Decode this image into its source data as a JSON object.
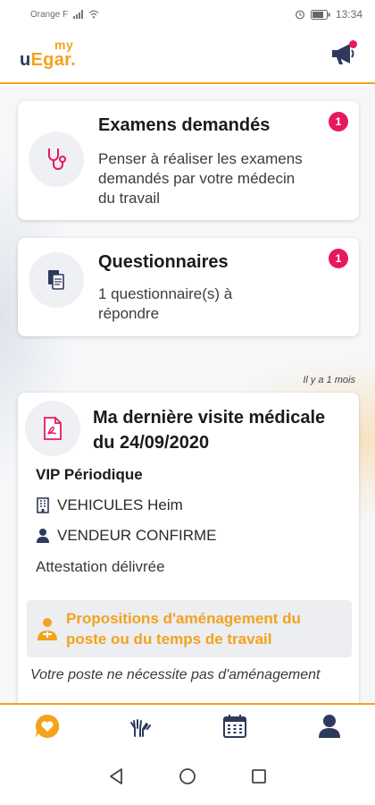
{
  "status_bar": {
    "carrier": "Orange F",
    "time": "13:34"
  },
  "header": {
    "logo_my": "my",
    "logo_u": "u",
    "logo_main": "Egar."
  },
  "cards": {
    "exams": {
      "title": "Examens demandés",
      "text": "Penser à réaliser les examens demandés par votre médecin du travail",
      "badge": "1"
    },
    "questionnaires": {
      "title": "Questionnaires",
      "text": "1 questionnaire(s) à répondre",
      "badge": "1"
    }
  },
  "last_visit": {
    "timestamp": "Il y a 1 mois",
    "title": "Ma dernière visite médicale du 24/09/2020",
    "type": "VIP Périodique",
    "company": "VEHICULES Heim",
    "job": "VENDEUR CONFIRME",
    "certificate": "Attestation délivrée",
    "adjustments_title": "Propositions d'aménagement du poste ou du temps de travail",
    "adjustments_note": "Votre poste ne nécessite pas d'aménagement"
  },
  "colors": {
    "accent": "#f4a21c",
    "badge": "#e6195e",
    "navy": "#2e3a5c"
  },
  "tabs": [
    {
      "icon": "heart-chat-icon",
      "active": true
    },
    {
      "icon": "hands-icon",
      "active": false
    },
    {
      "icon": "calendar-icon",
      "active": false
    },
    {
      "icon": "user-icon",
      "active": false
    }
  ]
}
